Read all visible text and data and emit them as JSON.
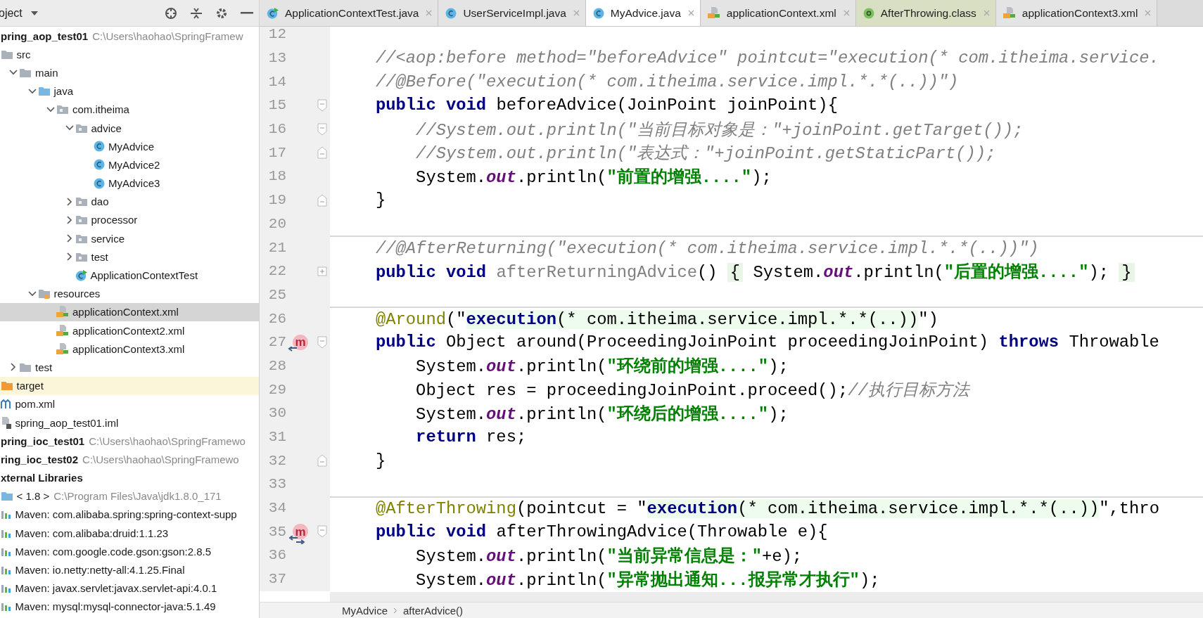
{
  "sidebar": {
    "title": "oject",
    "tree": [
      {
        "label": "pring_aop_test01",
        "path": "C:\\Users\\haohao\\SpringFramew",
        "selected": false,
        "children": [
          {
            "label": "src",
            "kind": "folder",
            "selected": false,
            "children": [
              {
                "label": "main",
                "kind": "folder",
                "selected": false,
                "expanded": true,
                "children": [
                  {
                    "label": "java",
                    "kind": "source-folder",
                    "selected": false,
                    "expanded": true,
                    "children": [
                      {
                        "label": "com.itheima",
                        "kind": "package",
                        "selected": false,
                        "expanded": true,
                        "children": [
                          {
                            "label": "advice",
                            "kind": "package",
                            "selected": false,
                            "expanded": true,
                            "children": [
                              {
                                "label": "MyAdvice",
                                "kind": "class",
                                "selected": false
                              },
                              {
                                "label": "MyAdvice2",
                                "kind": "class",
                                "selected": false
                              },
                              {
                                "label": "MyAdvice3",
                                "kind": "class",
                                "selected": false
                              }
                            ]
                          },
                          {
                            "label": "dao",
                            "kind": "package",
                            "selected": false,
                            "expanded": false
                          },
                          {
                            "label": "processor",
                            "kind": "package",
                            "selected": false,
                            "expanded": false
                          },
                          {
                            "label": "service",
                            "kind": "package",
                            "selected": false,
                            "expanded": false
                          },
                          {
                            "label": "test",
                            "kind": "package",
                            "selected": false,
                            "expanded": false
                          },
                          {
                            "label": "ApplicationContextTest",
                            "kind": "test-class",
                            "selected": false
                          }
                        ]
                      }
                    ]
                  },
                  {
                    "label": "resources",
                    "kind": "resources-folder",
                    "selected": false,
                    "expanded": true,
                    "children": [
                      {
                        "label": "applicationContext.xml",
                        "kind": "xml",
                        "selected": true
                      },
                      {
                        "label": "applicationContext2.xml",
                        "kind": "xml",
                        "selected": false
                      },
                      {
                        "label": "applicationContext3.xml",
                        "kind": "xml",
                        "selected": false
                      }
                    ]
                  }
                ]
              },
              {
                "label": "test",
                "kind": "folder",
                "selected": false,
                "expanded": false
              }
            ]
          },
          {
            "label": "target",
            "kind": "excluded-folder",
            "selected": false
          },
          {
            "label": "pom.xml",
            "kind": "maven",
            "selected": false
          },
          {
            "label": "spring_aop_test01.iml",
            "kind": "iml",
            "selected": false
          }
        ]
      },
      {
        "label": "pring_ioc_test01",
        "path": "C:\\Users\\haohao\\SpringFramewo",
        "selected": false
      },
      {
        "label": "ring_ioc_test02",
        "path": "C:\\Users\\haohao\\SpringFramewo",
        "selected": false
      },
      {
        "label": "xternal Libraries",
        "selected": false,
        "children": [
          {
            "label": "< 1.8 >",
            "path": "C:\\Program Files\\Java\\jdk1.8.0_171",
            "kind": "jdk",
            "selected": false
          },
          {
            "label": "Maven: com.alibaba.spring:spring-context-supp",
            "kind": "library",
            "selected": false
          },
          {
            "label": "Maven: com.alibaba:druid:1.1.23",
            "kind": "library",
            "selected": false
          },
          {
            "label": "Maven: com.google.code.gson:gson:2.8.5",
            "kind": "library",
            "selected": false
          },
          {
            "label": "Maven: io.netty:netty-all:4.1.25.Final",
            "kind": "library",
            "selected": false
          },
          {
            "label": "Maven: javax.servlet:javax.servlet-api:4.0.1",
            "kind": "library",
            "selected": false
          },
          {
            "label": "Maven: mysql:mysql-connector-java:5.1.49",
            "kind": "library",
            "selected": false
          }
        ]
      }
    ]
  },
  "tabs": [
    {
      "label": "ApplicationContextTest.java",
      "kind": "test-class",
      "selected": false
    },
    {
      "label": "UserServiceImpl.java",
      "kind": "class",
      "selected": false
    },
    {
      "label": "MyAdvice.java",
      "kind": "class",
      "selected": true
    },
    {
      "label": "applicationContext.xml",
      "kind": "xml",
      "selected": false
    },
    {
      "label": "AfterThrowing.class",
      "kind": "annotation",
      "selected": false
    },
    {
      "label": "applicationContext3.xml",
      "kind": "xml",
      "selected": false
    }
  ],
  "editor": {
    "lines": [
      {
        "number": "12"
      },
      {
        "number": "13",
        "tokens": [
          {
            "kind": "comment",
            "text": "//<aop:before method=\"beforeAdvice\" pointcut=\"execution(* com.itheima.service."
          }
        ]
      },
      {
        "number": "14",
        "tokens": [
          {
            "kind": "comment",
            "text": "//@Before(\"execution(* com.itheima.service.impl.*.*(..))\")"
          }
        ]
      },
      {
        "number": "15",
        "fold": {
          "kind": "start"
        },
        "tokens": [
          {
            "kind": "keyword",
            "text": "public void "
          },
          {
            "kind": "plain",
            "text": "beforeAdvice(JoinPoint joinPoint){"
          }
        ]
      },
      {
        "number": "16",
        "fold": {
          "kind": "start"
        },
        "tokens": [
          {
            "kind": "comment",
            "text": "    //System.out.println(\"当前目标对象是：\"+joinPoint.getTarget());"
          }
        ]
      },
      {
        "number": "17",
        "fold": {
          "kind": "end"
        },
        "tokens": [
          {
            "kind": "comment",
            "text": "    //System.out.println(\"表达式：\"+joinPoint.getStaticPart());"
          }
        ]
      },
      {
        "number": "18",
        "tokens": [
          {
            "kind": "plain",
            "text": "    System."
          },
          {
            "kind": "field",
            "text": "out"
          },
          {
            "kind": "plain",
            "text": ".println("
          },
          {
            "kind": "string",
            "text": "\"前置的增强....\""
          },
          {
            "kind": "plain",
            "text": ");"
          }
        ]
      },
      {
        "number": "19",
        "fold": {
          "kind": "end"
        },
        "tokens": [
          {
            "kind": "plain",
            "text": "}"
          }
        ]
      },
      {
        "number": "20"
      },
      {
        "number": "21",
        "separator": true,
        "tokens": [
          {
            "kind": "comment",
            "text": "//@AfterReturning(\"execution(* com.itheima.service.impl.*.*(..))\")"
          }
        ]
      },
      {
        "number": "22",
        "fold": {
          "kind": "collapsed"
        },
        "tokens": [
          {
            "kind": "keyword",
            "text": "public void "
          },
          {
            "kind": "unused",
            "text": "afterReturningAdvice"
          },
          {
            "kind": "plain",
            "text": "() "
          },
          {
            "kind": "folded",
            "text": "{"
          },
          {
            "kind": "plain",
            "text": " System."
          },
          {
            "kind": "field",
            "text": "out"
          },
          {
            "kind": "plain",
            "text": ".println("
          },
          {
            "kind": "string",
            "text": "\"后置的增强....\""
          },
          {
            "kind": "plain",
            "text": "); "
          },
          {
            "kind": "folded",
            "text": "}"
          }
        ]
      },
      {
        "number": "25"
      },
      {
        "number": "26",
        "separator": true,
        "tokens": [
          {
            "kind": "annotation",
            "text": "@Around"
          },
          {
            "kind": "plain",
            "text": "(\""
          },
          {
            "kind": "injected-keyword",
            "text": "execution"
          },
          {
            "kind": "injected",
            "text": "(* com.itheima.service.impl.*.*(..))"
          },
          {
            "kind": "plain",
            "text": "\")"
          }
        ]
      },
      {
        "number": "27",
        "fold": {
          "kind": "start"
        },
        "marker": {
          "label": "m",
          "kind": "around"
        },
        "tokens": [
          {
            "kind": "keyword",
            "text": "public "
          },
          {
            "kind": "plain",
            "text": "Object around(ProceedingJoinPoint proceedingJoinPoint) "
          },
          {
            "kind": "keyword",
            "text": "throws "
          },
          {
            "kind": "plain",
            "text": "Throwable"
          }
        ]
      },
      {
        "number": "28",
        "tokens": [
          {
            "kind": "plain",
            "text": "    System."
          },
          {
            "kind": "field",
            "text": "out"
          },
          {
            "kind": "plain",
            "text": ".println("
          },
          {
            "kind": "string",
            "text": "\"环绕前的增强....\""
          },
          {
            "kind": "plain",
            "text": ");"
          }
        ]
      },
      {
        "number": "29",
        "tokens": [
          {
            "kind": "plain",
            "text": "    Object res = proceedingJoinPoint.proceed();"
          },
          {
            "kind": "comment",
            "text": "//执行目标方法"
          }
        ]
      },
      {
        "number": "30",
        "tokens": [
          {
            "kind": "plain",
            "text": "    System."
          },
          {
            "kind": "field",
            "text": "out"
          },
          {
            "kind": "plain",
            "text": ".println("
          },
          {
            "kind": "string",
            "text": "\"环绕后的增强....\""
          },
          {
            "kind": "plain",
            "text": ");"
          }
        ]
      },
      {
        "number": "31",
        "tokens": [
          {
            "kind": "keyword",
            "text": "    return "
          },
          {
            "kind": "plain",
            "text": "res;"
          }
        ]
      },
      {
        "number": "32",
        "fold": {
          "kind": "end"
        },
        "tokens": [
          {
            "kind": "plain",
            "text": "}"
          }
        ]
      },
      {
        "number": "33"
      },
      {
        "number": "34",
        "separator": true,
        "tokens": [
          {
            "kind": "annotation",
            "text": "@AfterThrowing"
          },
          {
            "kind": "plain",
            "text": "(pointcut = \""
          },
          {
            "kind": "injected-keyword",
            "text": "execution"
          },
          {
            "kind": "injected",
            "text": "(* com.itheima.service.impl.*.*(..))"
          },
          {
            "kind": "plain",
            "text": "\",thro"
          }
        ]
      },
      {
        "number": "35",
        "fold": {
          "kind": "start"
        },
        "marker": {
          "label": "m",
          "kind": "throwing"
        },
        "tokens": [
          {
            "kind": "keyword",
            "text": "public void "
          },
          {
            "kind": "plain",
            "text": "afterThrowingAdvice(Throwable e){"
          }
        ]
      },
      {
        "number": "36",
        "tokens": [
          {
            "kind": "plain",
            "text": "    System."
          },
          {
            "kind": "field",
            "text": "out"
          },
          {
            "kind": "plain",
            "text": ".println("
          },
          {
            "kind": "string",
            "text": "\"当前异常信息是：\""
          },
          {
            "kind": "plain",
            "text": "+e);"
          }
        ]
      },
      {
        "number": "37",
        "tokens": [
          {
            "kind": "plain",
            "text": "    System."
          },
          {
            "kind": "field",
            "text": "out"
          },
          {
            "kind": "plain",
            "text": ".println("
          },
          {
            "kind": "string",
            "text": "\"异常抛出通知...报异常才执行\""
          },
          {
            "kind": "plain",
            "text": ");"
          }
        ]
      }
    ]
  },
  "breadcrumbs": [
    "MyAdvice",
    "afterAdvice()"
  ]
}
